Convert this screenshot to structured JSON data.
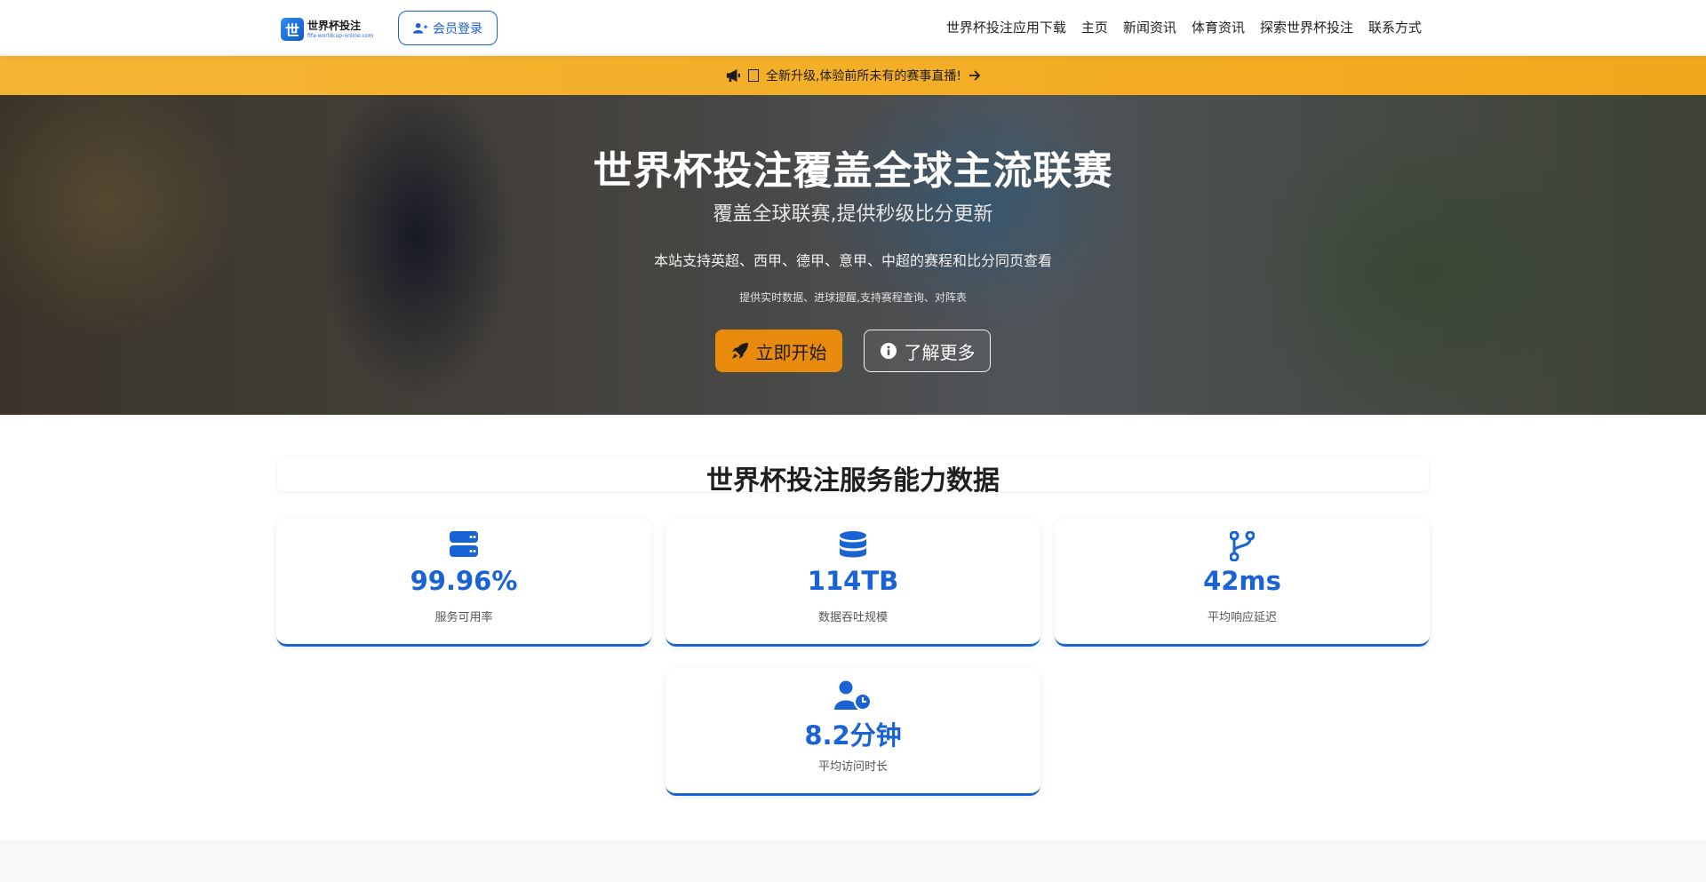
{
  "header": {
    "logo_title": "世界杯投注",
    "logo_subtitle": "fifa-worldcup-online.com",
    "logo_mark": "世",
    "login_label": "会员登录",
    "nav": [
      {
        "label": "世界杯投注应用下载"
      },
      {
        "label": "主页"
      },
      {
        "label": "新闻资讯"
      },
      {
        "label": "体育资讯"
      },
      {
        "label": "探索世界杯投注"
      },
      {
        "label": "联系方式"
      }
    ]
  },
  "announcement": {
    "icon": "megaphone-icon",
    "text": "全新升级,体验前所未有的赛事直播!"
  },
  "hero": {
    "title": "世界杯投注覆盖全球主流联赛",
    "subtitle": "覆盖全球联赛,提供秒级比分更新",
    "description": "本站支持英超、西甲、德甲、意甲、中超的赛程和比分同页查看",
    "small_text": "提供实时数据、进球提醒,支持赛程查询、对阵表",
    "start_label": "立即开始",
    "more_label": "了解更多"
  },
  "stats": {
    "title": "世界杯投注服务能力数据",
    "items": [
      {
        "icon": "server-icon",
        "value": "99.96%",
        "label": "服务可用率"
      },
      {
        "icon": "database-icon",
        "value": "114TB",
        "label": "数据吞吐规模"
      },
      {
        "icon": "code-branch-icon",
        "value": "42ms",
        "label": "平均响应延迟"
      },
      {
        "icon": "user-clock-icon",
        "value": "8.2分钟",
        "label": "平均访问时长"
      }
    ]
  },
  "colors": {
    "accent": "#1a63d4",
    "announce_bg": "#f5b534",
    "start_button": "#e88a0c"
  }
}
